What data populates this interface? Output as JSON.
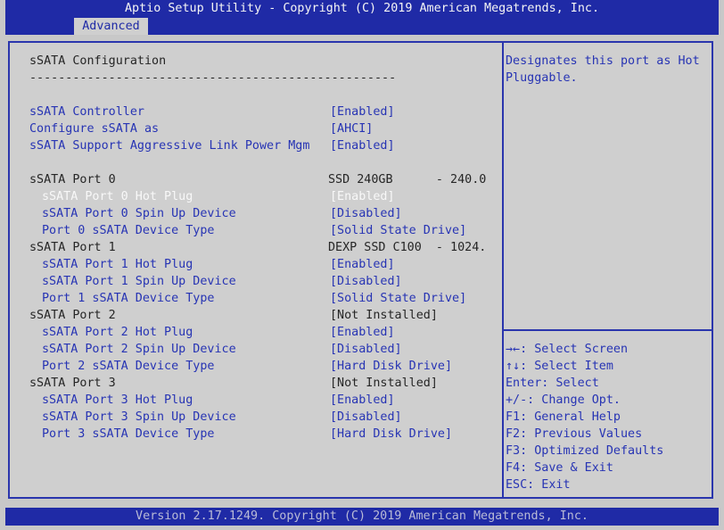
{
  "header": {
    "title": "Aptio Setup Utility - Copyright (C) 2019 American Megatrends, Inc.",
    "active_tab": "Advanced"
  },
  "page": {
    "title": "sSATA Configuration",
    "separator": "---------------------------------------------------"
  },
  "settings": [
    {
      "label": "sSATA Controller",
      "value": "[Enabled]"
    },
    {
      "label": "Configure sSATA as",
      "value": "[AHCI]"
    },
    {
      "label": "sSATA Support Aggressive Link Power Mgm",
      "value": "[Enabled]"
    }
  ],
  "ports": [
    {
      "header": "sSATA Port 0",
      "info": "SSD 240GB      - 240.0",
      "hot_plug_label": "sSATA Port 0 Hot Plug",
      "hot_plug_value": "[Enabled]",
      "spin_label": "sSATA Port 0 Spin Up Device",
      "spin_value": "[Disabled]",
      "type_label": "Port 0 sSATA Device Type",
      "type_value": "[Solid State Drive]"
    },
    {
      "header": "sSATA Port 1",
      "info": "DEXP SSD C100  - 1024.",
      "hot_plug_label": "sSATA Port 1 Hot Plug",
      "hot_plug_value": "[Enabled]",
      "spin_label": "sSATA Port 1 Spin Up Device",
      "spin_value": "[Disabled]",
      "type_label": "Port 1 sSATA Device Type",
      "type_value": "[Solid State Drive]"
    },
    {
      "header": "sSATA Port 2",
      "info": "[Not Installed]",
      "hot_plug_label": "sSATA Port 2 Hot Plug",
      "hot_plug_value": "[Enabled]",
      "spin_label": "sSATA Port 2 Spin Up Device",
      "spin_value": "[Disabled]",
      "type_label": "Port 2 sSATA Device Type",
      "type_value": "[Hard Disk Drive]"
    },
    {
      "header": "sSATA Port 3",
      "info": "[Not Installed]",
      "hot_plug_label": "sSATA Port 3 Hot Plug",
      "hot_plug_value": "[Enabled]",
      "spin_label": "sSATA Port 3 Spin Up Device",
      "spin_value": "[Disabled]",
      "type_label": "Port 3 sSATA Device Type",
      "type_value": "[Hard Disk Drive]"
    }
  ],
  "help": {
    "line1": "Designates this port as Hot",
    "line2": "Pluggable."
  },
  "keys": [
    "→←: Select Screen",
    "↑↓: Select Item",
    "Enter: Select",
    "+/-: Change Opt.",
    "F1: General Help",
    "F2: Previous Values",
    "F3: Optimized Defaults",
    "F4: Save & Exit",
    "ESC: Exit"
  ],
  "footer": "Version 2.17.1249. Copyright (C) 2019 American Megatrends, Inc.",
  "colors": {
    "header_blue": "#1f2aa6",
    "setting_blue": "#2734b4",
    "background_gray": "#cfcfcf",
    "selected_white": "#f8f8f8"
  }
}
